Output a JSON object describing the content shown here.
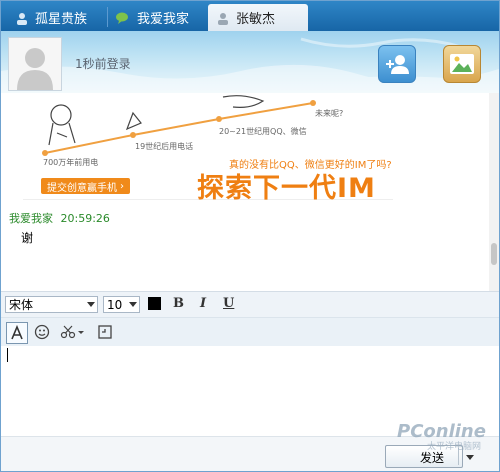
{
  "tabs": [
    {
      "label": "孤星贵族",
      "active": false
    },
    {
      "label": "我爱我家",
      "active": false
    },
    {
      "label": "张敏杰",
      "active": true
    }
  ],
  "contact": {
    "status_text": "1秒前登录"
  },
  "banner": {
    "milestones": [
      "700万年前用电",
      "19世纪后用电话",
      "20~21世纪用QQ、微信",
      "未来呢?"
    ],
    "question": "真的没有比QQ、微信更好的IM了吗?",
    "headline": "探索下一代IM",
    "cta_label": "提交创意赢手机"
  },
  "message": {
    "sender": "我爱我家",
    "time": "20:59:26",
    "text": "谢"
  },
  "format": {
    "font_family": "宋体",
    "font_size": "10",
    "bold": "B",
    "italic": "I",
    "underline": "U",
    "color": "#000000"
  },
  "footer": {
    "send_label": "发送"
  },
  "watermark": {
    "brand": "PConline",
    "sub": "太平洋电脑网"
  },
  "colors": {
    "tab_bar": "#1f73b6",
    "accent_orange": "#ef7f12",
    "sender_green": "#2a8a2a"
  }
}
